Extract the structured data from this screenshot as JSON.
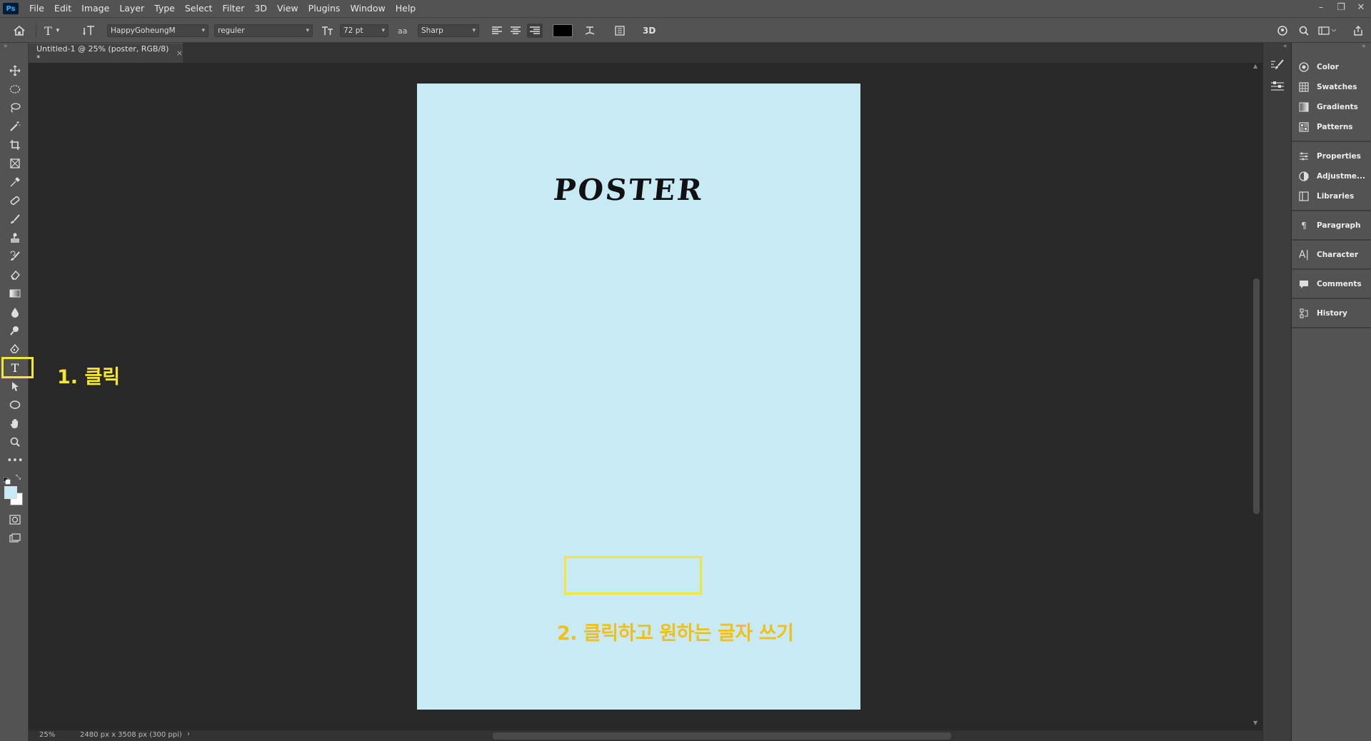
{
  "app": {
    "logo": "Ps"
  },
  "menu": [
    "File",
    "Edit",
    "Image",
    "Layer",
    "Type",
    "Select",
    "Filter",
    "3D",
    "View",
    "Plugins",
    "Window",
    "Help"
  ],
  "window_controls": {
    "minimize": "–",
    "restore": "❐",
    "close": "✕"
  },
  "options_bar": {
    "font_family": "HappyGoheungM",
    "font_style": "reguler",
    "font_size": "72 pt",
    "antialias": "Sharp",
    "aa_icon_label": "aa",
    "three_d_label": "3D",
    "text_color": "#000000"
  },
  "document_tab": {
    "title": "Untitled-1 @ 25% (poster, RGB/8) *",
    "close": "×"
  },
  "canvas": {
    "background": "#c8eaf5",
    "poster_text": "POSTER",
    "instruction_1": "1. 클릭",
    "instruction_2": "2. 클릭하고 원하는 글자 쓰기",
    "highlight_color": "#f5e631"
  },
  "status_bar": {
    "zoom": "25%",
    "doc_info": "2480 px x 3508 px (300 ppi)",
    "arrow": "›"
  },
  "panels": [
    {
      "label": "Color",
      "icon": "color-icon"
    },
    {
      "label": "Swatches",
      "icon": "swatches-icon"
    },
    {
      "label": "Gradients",
      "icon": "gradients-icon"
    },
    {
      "label": "Patterns",
      "icon": "patterns-icon"
    },
    {
      "label": "Properties",
      "icon": "properties-icon"
    },
    {
      "label": "Adjustme...",
      "icon": "adjustments-icon"
    },
    {
      "label": "Libraries",
      "icon": "libraries-icon"
    },
    {
      "label": "Paragraph",
      "icon": "paragraph-icon"
    },
    {
      "label": "Character",
      "icon": "character-icon"
    },
    {
      "label": "Comments",
      "icon": "comments-icon"
    },
    {
      "label": "History",
      "icon": "history-icon"
    }
  ],
  "tools": [
    "move-tool",
    "marquee-tool",
    "lasso-tool",
    "magic-wand-tool",
    "crop-tool",
    "frame-tool",
    "eyedropper-tool",
    "healing-tool",
    "brush-tool",
    "stamp-tool",
    "history-brush-tool",
    "eraser-tool",
    "gradient-tool",
    "blur-tool",
    "dodge-tool",
    "pen-tool",
    "type-tool",
    "path-select-tool",
    "ellipse-tool",
    "hand-tool",
    "zoom-tool",
    "more-tools"
  ]
}
